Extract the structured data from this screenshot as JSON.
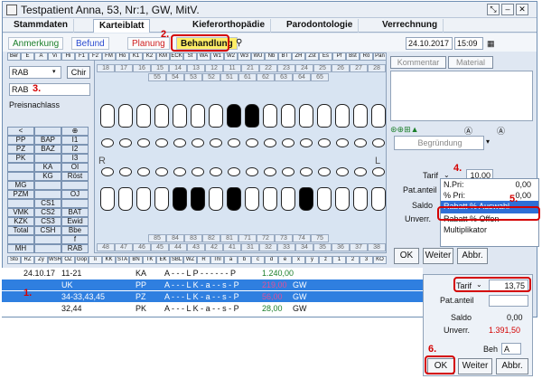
{
  "window": {
    "title": "Testpatient Anna, 53, Nr:1, GW, MitV."
  },
  "tabs": [
    "Stammdaten",
    "Karteiblatt",
    "Kieferorthopädie",
    "Parodontologie",
    "Verrechnung"
  ],
  "subtabs": [
    "Anmerkung",
    "Befund",
    "Planung",
    "Behandlung"
  ],
  "header": {
    "date": "24.10.2017",
    "time": "15:09"
  },
  "codes_top": [
    "Ber",
    "E",
    "A",
    "Vi",
    "Hi",
    "F1",
    "F2",
    "FM",
    "Ho",
    "K1",
    "K2",
    "KM",
    "ECK",
    "St",
    "WA",
    "W1",
    "W2",
    "W3",
    "WU",
    "Nb",
    "BT",
    "ZH",
    "Zst",
    "Es",
    "Pf",
    "Bst",
    "Rö",
    "Pan"
  ],
  "left": {
    "rab_value": "RAB",
    "chir_label": "Chir",
    "rab_text": "RAB",
    "preis_label": "Preisnachlass"
  },
  "codegrid": [
    [
      "<",
      "",
      "⊕"
    ],
    [
      "PP",
      "BAP",
      "I1"
    ],
    [
      "PZ",
      "BAZ",
      "I2"
    ],
    [
      "PK",
      "",
      "I3"
    ],
    [
      "",
      "KA",
      "OI"
    ],
    [
      "",
      "KG",
      "Röst"
    ],
    [
      "MG",
      "",
      ""
    ],
    [
      "PZM",
      "",
      "OJ"
    ],
    [
      "",
      "CS1",
      ""
    ],
    [
      "VMK",
      "CS2",
      "BAT"
    ],
    [
      "KZK",
      "CS3",
      "Ewid"
    ],
    [
      "Total",
      "CSH",
      "Bbe"
    ],
    [
      "",
      "",
      "f"
    ],
    [
      "MH",
      "",
      "RAB"
    ]
  ],
  "upper_nums_a": [
    "18",
    "17",
    "16",
    "15",
    "14",
    "13",
    "12",
    "11",
    "21",
    "22",
    "23",
    "24",
    "25",
    "26",
    "27",
    "28"
  ],
  "upper_nums_b": [
    "55",
    "54",
    "53",
    "52",
    "51",
    "61",
    "62",
    "63",
    "64",
    "65"
  ],
  "lower_nums_b": [
    "85",
    "84",
    "83",
    "82",
    "81",
    "71",
    "72",
    "73",
    "74",
    "75"
  ],
  "lower_nums_a": [
    "48",
    "47",
    "46",
    "45",
    "44",
    "43",
    "42",
    "41",
    "31",
    "32",
    "33",
    "34",
    "35",
    "36",
    "37",
    "38"
  ],
  "side_labels": {
    "R": "R",
    "L": "L"
  },
  "codes_bottom": [
    "Sto",
    "RZ",
    "Zy",
    "WSR",
    "OZ",
    "Gop",
    "li",
    "KK",
    "STA",
    "BN",
    "TK",
    "EK",
    "SBL",
    "WZ",
    "R",
    "Thl",
    "a",
    "b",
    "c",
    "d",
    "e",
    "x",
    "y",
    "z",
    "1",
    "2",
    "3",
    "KO"
  ],
  "right": {
    "kommentar": "Kommentar",
    "material": "Material",
    "begruendung": "Begründung",
    "tarif_label": "Tarif",
    "tarif_value": "10,00",
    "patanteil_label": "Pat.anteil",
    "saldo_label": "Saldo",
    "unverr_label": "Unverr."
  },
  "dropdown": [
    {
      "label": "N.Pri:",
      "value": "0,00"
    },
    {
      "label": "% Pri:",
      "value": "0,00"
    },
    {
      "label": "Rabatt % Auswahl",
      "value": ""
    },
    {
      "label": "Rabatt % Offen",
      "value": ""
    },
    {
      "label": "Multiplikator",
      "value": ""
    }
  ],
  "buttons1": {
    "ok": "OK",
    "weiter": "Weiter",
    "abbr": "Abbr."
  },
  "list": [
    {
      "date": "24.10.17",
      "teeth": "11-21",
      "code": "KA",
      "flags": "A - - - L P - - - - - - P",
      "amount": "1.240,00",
      "gw": ""
    },
    {
      "date": "",
      "teeth": "UK",
      "code": "PP",
      "flags": "A - - - L K - a - - s - P",
      "amount": "219,00",
      "gw": "GW"
    },
    {
      "date": "",
      "teeth": "34-33,43,45",
      "code": "PZ",
      "flags": "A - - - L K - a - - s - P",
      "amount": "56,00",
      "gw": "GW"
    },
    {
      "date": "",
      "teeth": "32,44",
      "code": "PK",
      "flags": "A - - - L K - a - - s - P",
      "amount": "28,00",
      "gw": "GW"
    }
  ],
  "popup": {
    "tarif_label": "Tarif",
    "tarif_value": "13,75",
    "patanteil_label": "Pat.anteil",
    "saldo_label": "Saldo",
    "saldo_value": "0,00",
    "unverr_label": "Unverr.",
    "unverr_value": "1.391,50",
    "beh_label": "Beh",
    "beh_value": "A",
    "ok": "OK",
    "weiter": "Weiter",
    "abbr": "Abbr."
  },
  "markers": [
    "1.",
    "2.",
    "3.",
    "4.",
    "5.",
    "6."
  ],
  "colors": {
    "accent_red": "#d40000",
    "selection": "#2f7fe0",
    "pink": "#e0509a"
  }
}
